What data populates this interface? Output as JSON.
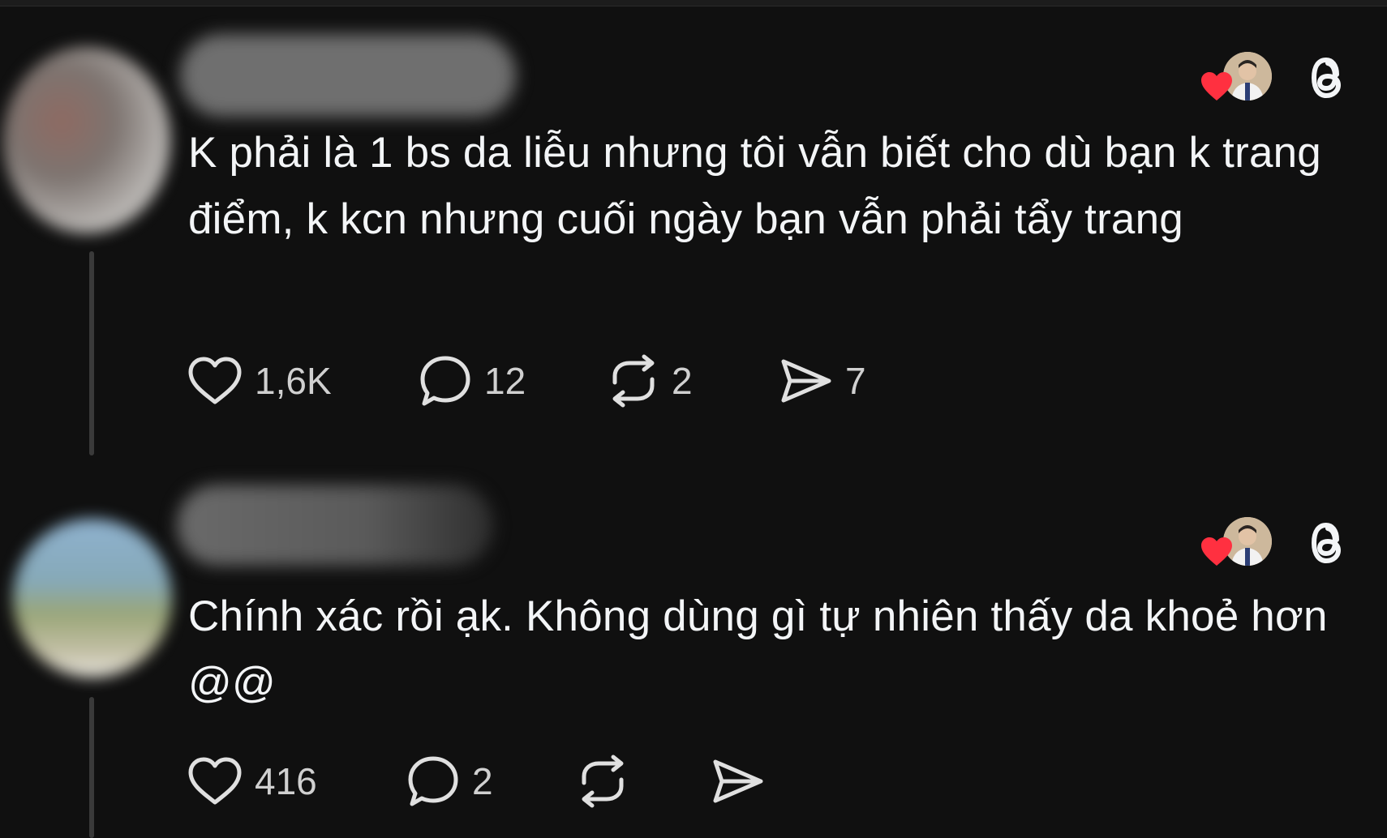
{
  "colors": {
    "background": "#101010",
    "text": "#f3f5f7",
    "muted": "#d0d0d0",
    "thread_line": "#3a3a3a",
    "heart": "#ff3040"
  },
  "posts": [
    {
      "avatar_icon": "blurred-profile-avatar",
      "username_icon": "blurred-username",
      "liked_by_icon": "creator-liked-badge",
      "logo_icon": "threads-logo-icon",
      "text": "K phải là 1 bs da liễu nhưng tôi vẫn biết cho dù bạn k trang điểm, k kcn nhưng cuối ngày bạn vẫn phải tẩy trang",
      "likes": "1,6K",
      "replies": "12",
      "reposts": "2",
      "shares": "7"
    },
    {
      "avatar_icon": "blurred-profile-avatar",
      "username_icon": "blurred-username",
      "liked_by_icon": "creator-liked-badge",
      "logo_icon": "threads-logo-icon",
      "text": "Chính xác rồi ạk. Không dùng gì tự nhiên thấy da khoẻ hơn @@",
      "likes": "416",
      "replies": "2",
      "reposts": "",
      "shares": ""
    }
  ]
}
